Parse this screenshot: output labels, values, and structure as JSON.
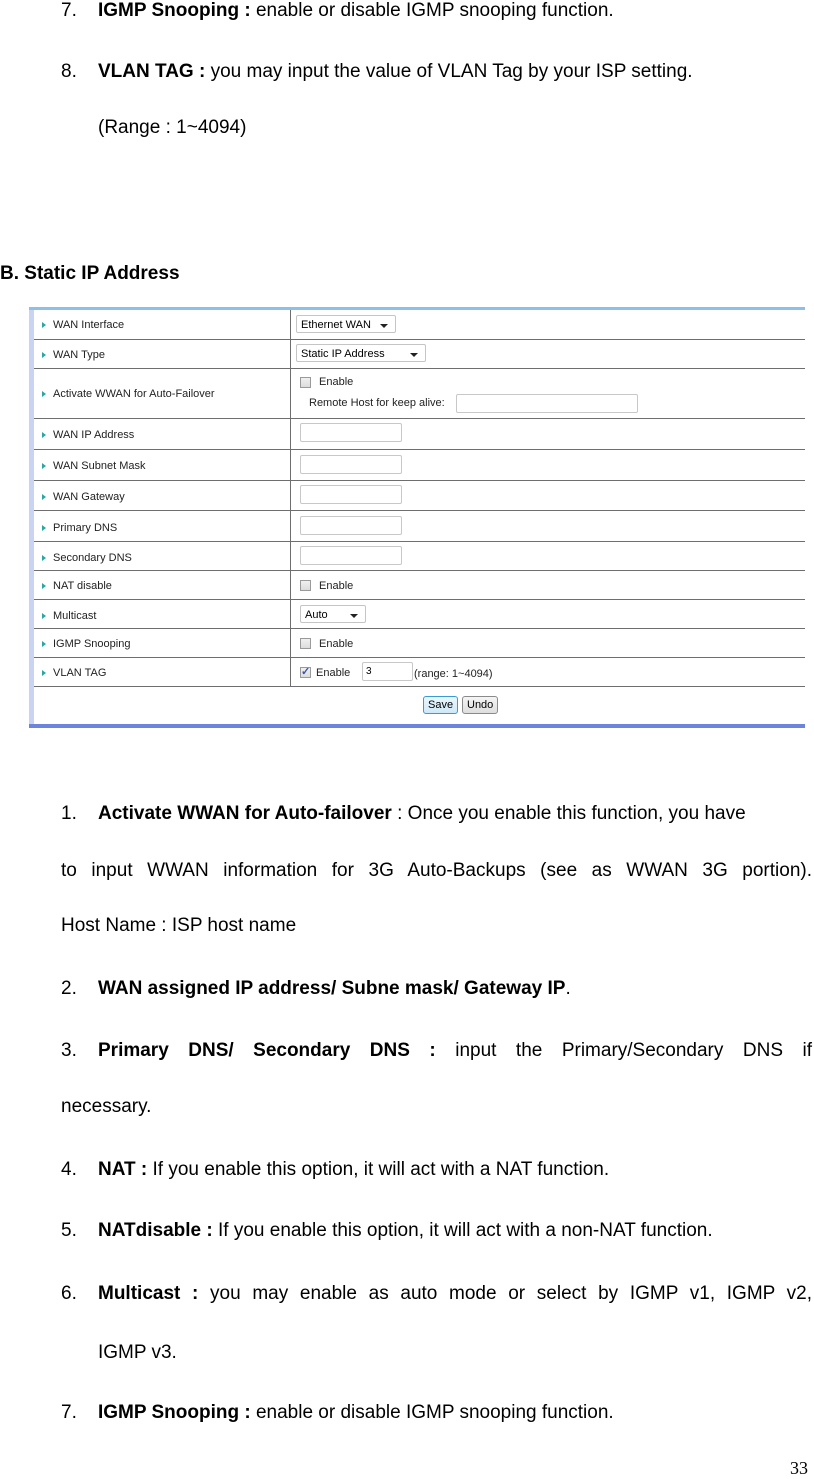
{
  "top_list": [
    {
      "num": "7.",
      "bold": "IGMP Snooping :",
      "text": " enable or disable IGMP snooping function."
    },
    {
      "num": "8.",
      "bold": "VLAN TAG :",
      "text": " you may input the value of VLAN Tag by your ISP setting.",
      "continuation": "(Range : 1~4094)"
    }
  ],
  "section_heading": "B. Static IP Address",
  "form": {
    "rows": [
      {
        "label": "WAN Interface",
        "control": "select",
        "value": "Ethernet WAN"
      },
      {
        "label": "WAN Type",
        "control": "select",
        "value": "Static IP Address"
      },
      {
        "label": "Activate WWAN for Auto-Failover",
        "control": "checkbox",
        "checked": false,
        "checkbox_label": "Enable",
        "extra_label": "Remote Host for keep alive:",
        "extra_value": ""
      },
      {
        "label": "WAN IP Address",
        "control": "text",
        "value": ""
      },
      {
        "label": "WAN Subnet Mask",
        "control": "text",
        "value": ""
      },
      {
        "label": "WAN Gateway",
        "control": "text",
        "value": ""
      },
      {
        "label": "Primary DNS",
        "control": "text",
        "value": ""
      },
      {
        "label": "Secondary DNS",
        "control": "text",
        "value": ""
      },
      {
        "label": "NAT disable",
        "control": "checkbox",
        "checked": false,
        "checkbox_label": "Enable"
      },
      {
        "label": "Multicast",
        "control": "select",
        "value": "Auto"
      },
      {
        "label": "IGMP Snooping",
        "control": "checkbox",
        "checked": false,
        "checkbox_label": "Enable"
      },
      {
        "label": "VLAN TAG",
        "control": "checkbox",
        "checked": true,
        "checkbox_label": "Enable",
        "input_value": "3",
        "hint": "(range: 1~4094)"
      }
    ],
    "save_label": "Save",
    "undo_label": "Undo",
    "colors": {
      "top_border": "#8ebfe6",
      "left_border": "#c9d3f2",
      "bottom_border": "#6c84dc",
      "arrow": "#2aa7a0"
    }
  },
  "bottom_list": [
    {
      "num": "1.",
      "bold": "Activate WWAN for Auto-failover",
      "text": " : Once you enable this function, you have",
      "line2": "to input WWAN information for 3G Auto-Backups (see as WWAN 3G portion).",
      "line3": "Host Name : ISP host name"
    },
    {
      "num": "2.",
      "bold": "WAN assigned IP address/ Subne mask/ Gateway IP",
      "text": "."
    },
    {
      "num": "3.",
      "bold": "Primary DNS/ Secondary DNS :",
      "text": " input the Primary/Secondary DNS if",
      "line2": "necessary."
    },
    {
      "num": "4.",
      "bold": "NAT :",
      "text": " If you enable this option, it will act with a NAT function."
    },
    {
      "num": "5.",
      "bold": "NATdisable :",
      "text": " If you enable this option, it will act with a non-NAT function."
    },
    {
      "num": "6.",
      "bold": "Multicast :",
      "text": " you may enable as auto mode or select by IGMP v1, IGMP v2,",
      "line2": "IGMP v3."
    },
    {
      "num": "7.",
      "bold": "IGMP Snooping :",
      "text": " enable or disable IGMP snooping function."
    }
  ],
  "page_number": "33"
}
